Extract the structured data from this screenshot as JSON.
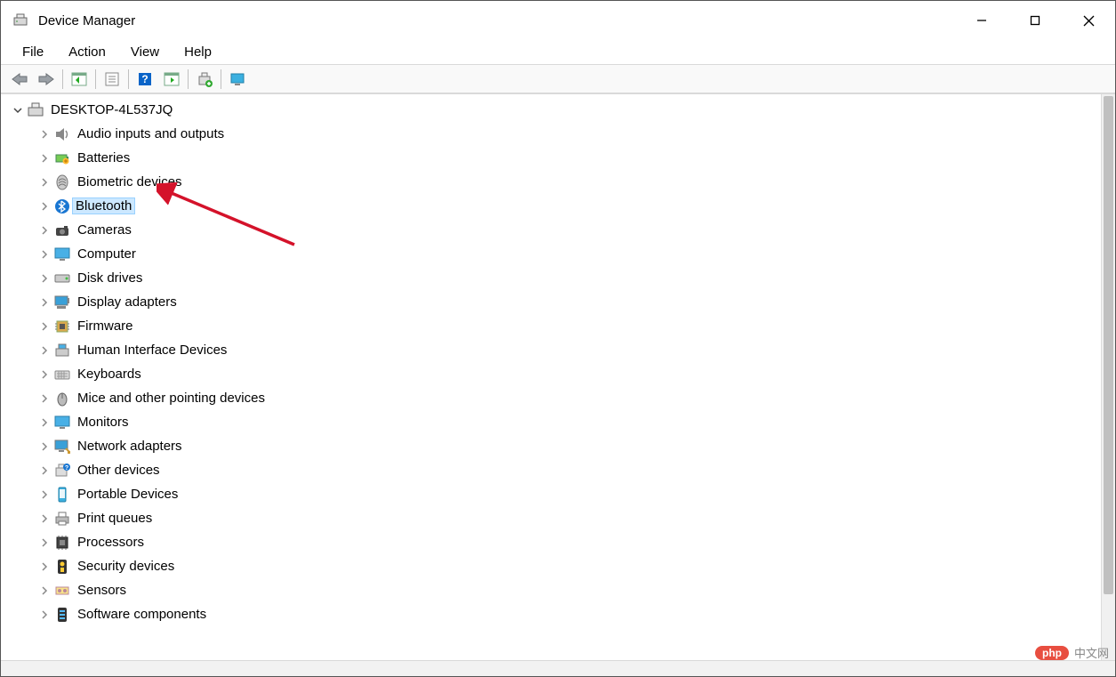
{
  "window": {
    "title": "Device Manager"
  },
  "menu": {
    "items": [
      "File",
      "Action",
      "View",
      "Help"
    ]
  },
  "toolbar": {
    "buttons": [
      "back",
      "forward",
      "show-hidden",
      "properties",
      "help",
      "scan",
      "add-legacy",
      "monitor"
    ]
  },
  "tree": {
    "root": {
      "label": "DESKTOP-4L537JQ",
      "icon": "computer-icon",
      "expanded": true
    },
    "children": [
      {
        "label": "Audio inputs and outputs",
        "icon": "audio-icon"
      },
      {
        "label": "Batteries",
        "icon": "battery-icon"
      },
      {
        "label": "Biometric devices",
        "icon": "biometric-icon"
      },
      {
        "label": "Bluetooth",
        "icon": "bluetooth-icon",
        "selected": true
      },
      {
        "label": "Cameras",
        "icon": "camera-icon"
      },
      {
        "label": "Computer",
        "icon": "monitor-icon"
      },
      {
        "label": "Disk drives",
        "icon": "disk-icon"
      },
      {
        "label": "Display adapters",
        "icon": "display-adapter-icon"
      },
      {
        "label": "Firmware",
        "icon": "chip-icon"
      },
      {
        "label": "Human Interface Devices",
        "icon": "hid-icon"
      },
      {
        "label": "Keyboards",
        "icon": "keyboard-icon"
      },
      {
        "label": "Mice and other pointing devices",
        "icon": "mouse-icon"
      },
      {
        "label": "Monitors",
        "icon": "monitor-icon"
      },
      {
        "label": "Network adapters",
        "icon": "network-icon"
      },
      {
        "label": "Other devices",
        "icon": "other-device-icon"
      },
      {
        "label": "Portable Devices",
        "icon": "phone-icon"
      },
      {
        "label": "Print queues",
        "icon": "printer-icon"
      },
      {
        "label": "Processors",
        "icon": "cpu-icon"
      },
      {
        "label": "Security devices",
        "icon": "security-icon"
      },
      {
        "label": "Sensors",
        "icon": "sensor-icon"
      },
      {
        "label": "Software components",
        "icon": "software-icon"
      }
    ]
  },
  "watermark": {
    "badge": "php",
    "text": "中文网"
  }
}
